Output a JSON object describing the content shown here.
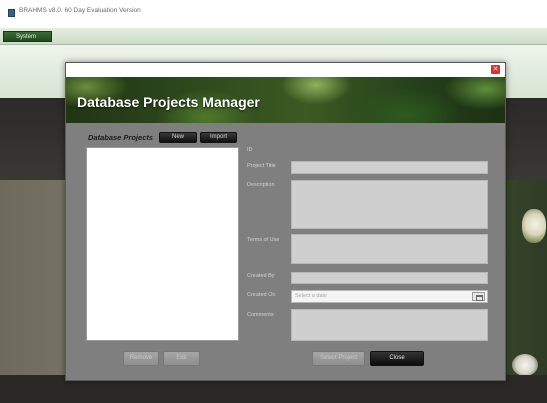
{
  "app": {
    "title": "BRAHMS v8.0. 60 Day Evaluation Version",
    "menu": {
      "system_label": "System"
    }
  },
  "dialog": {
    "title": "Database Projects Manager",
    "close_icon": "close-icon",
    "projects_label": "Database Projects",
    "new_button": "New",
    "import_button": "Import",
    "remove_button": "Remove",
    "edit_button": "Edit",
    "select_button": "Select Project",
    "close_button": "Close",
    "fields": {
      "id_label": "ID",
      "title_label": "Project Title",
      "description_label": "Description",
      "terms_label": "Terms of Use",
      "created_by_label": "Created By",
      "created_on_label": "Created On",
      "created_on_placeholder": "Select a date",
      "comments_label": "Comments"
    }
  },
  "colors": {
    "accent_green": "#1e4a1e",
    "dialog_bg": "#7f7f7f",
    "close_red": "#d9362b"
  }
}
